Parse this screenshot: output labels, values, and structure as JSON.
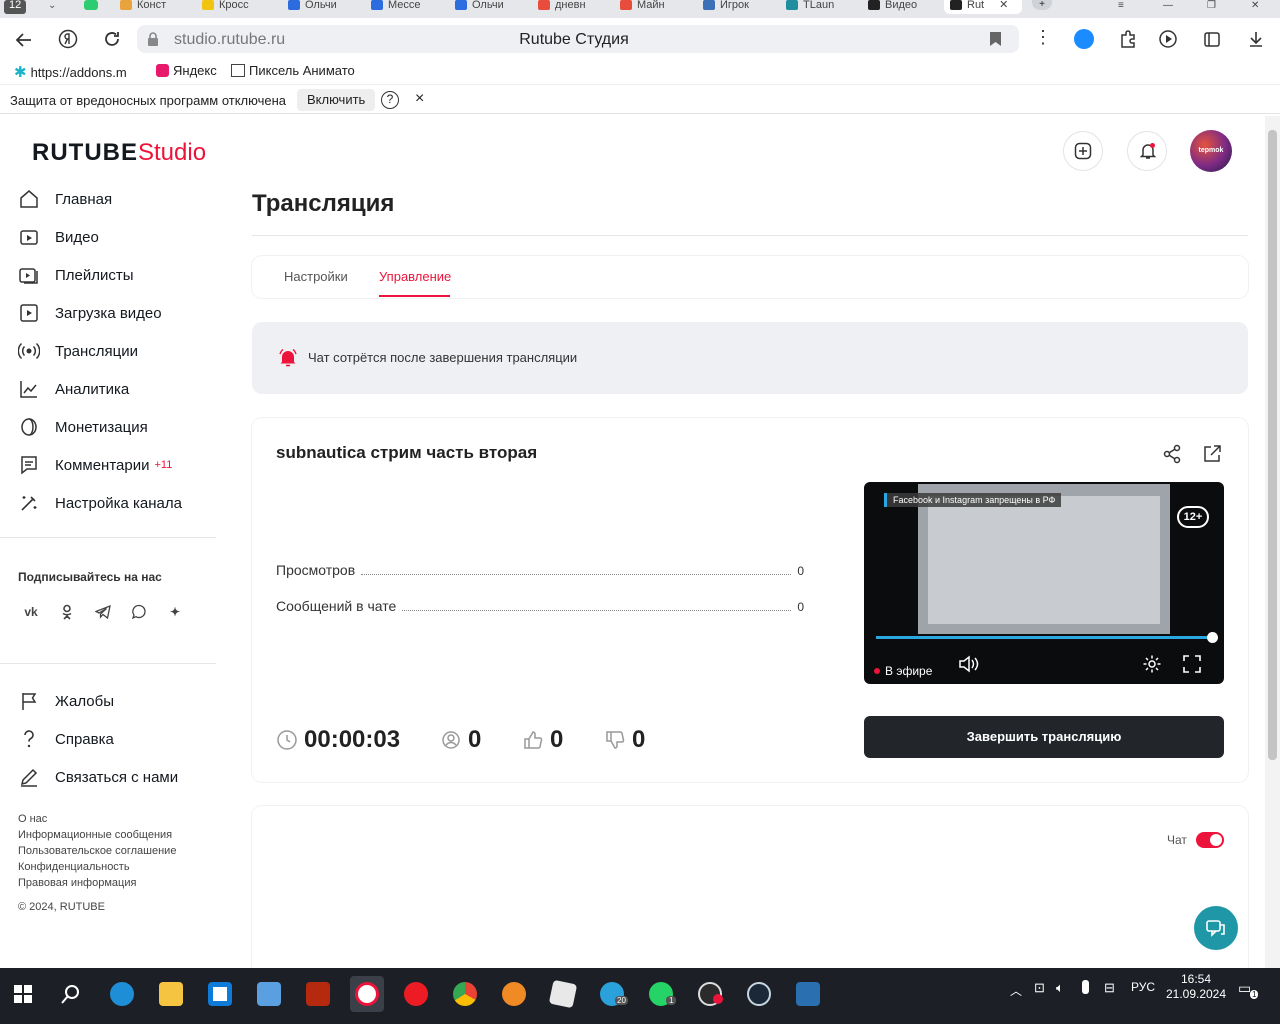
{
  "browser": {
    "tab_count": "12",
    "tabs": [
      "Конст",
      "Кросс",
      "Ольчи",
      "Мессе",
      "Ольчи",
      "дневн",
      "Майн",
      "Игрок",
      "TLaun",
      "Видео",
      "Rut"
    ],
    "url": "studio.rutube.ru",
    "page_title": "Rutube Студия",
    "bookmarks": [
      "https://addons.m",
      "Яндекс",
      "Пиксель Анимато"
    ],
    "warning": {
      "text": "Защита от вредоносных программ отключена",
      "enable_label": "Включить",
      "help": "?",
      "close": "×"
    }
  },
  "app": {
    "logo_main": "RUTUBE",
    "logo_studio": "Studio",
    "avatar_text": "tepmok",
    "nav": [
      {
        "label": "Главная",
        "icon": "home-icon"
      },
      {
        "label": "Видео",
        "icon": "video-icon"
      },
      {
        "label": "Плейлисты",
        "icon": "playlist-icon"
      },
      {
        "label": "Загрузка видео",
        "icon": "upload-icon"
      },
      {
        "label": "Трансляции",
        "icon": "broadcast-icon"
      },
      {
        "label": "Аналитика",
        "icon": "analytics-icon"
      },
      {
        "label": "Монетизация",
        "icon": "monetization-icon"
      },
      {
        "label": "Комментарии",
        "icon": "comments-icon",
        "badge": "+11"
      },
      {
        "label": "Настройка канала",
        "icon": "wand-icon"
      }
    ],
    "subscribe_title": "Подписывайтесь на нас",
    "social": [
      "vk-icon",
      "ok-icon",
      "telegram-icon",
      "viber-icon",
      "zen-icon"
    ],
    "nav_bottom": [
      {
        "label": "Жалобы",
        "icon": "flag-icon"
      },
      {
        "label": "Справка",
        "icon": "help-icon"
      },
      {
        "label": "Связаться с нами",
        "icon": "edit-icon"
      }
    ],
    "footer_links": [
      "О нас",
      "Информационные сообщения",
      "Пользовательское соглашение",
      "Конфиденциальность",
      "Правовая информация",
      "© 2024, RUTUBE"
    ]
  },
  "main": {
    "title": "Трансляция",
    "tabs": [
      {
        "label": "Настройки"
      },
      {
        "label": "Управление"
      }
    ],
    "active_tab": "Управление",
    "notice": "Чат сотрётся после завершения трансляции",
    "stream": {
      "title": "subnautica стрим часть вторая",
      "stats": [
        {
          "label": "Просмотров",
          "value": "0"
        },
        {
          "label": "Сообщений в чате",
          "value": "0"
        }
      ],
      "timer": "00:00:03",
      "viewers": "0",
      "likes": "0",
      "dislikes": "0",
      "player": {
        "notice": "Facebook и Instagram запрещены в РФ",
        "age": "12+",
        "live_label": "В эфире",
        "progress": 1.0
      },
      "end_button": "Завершить трансляцию"
    },
    "chat": {
      "label": "Чат",
      "enabled": true
    }
  },
  "taskbar": {
    "language": "РУС",
    "time": "16:54",
    "date": "21.09.2024",
    "telegram_badge": "20",
    "whatsapp_badge": "1",
    "notif_badge": "1"
  },
  "colors": {
    "accent": "#ed143b",
    "dark_button": "#22262b",
    "help_button": "#1f97a6",
    "progress": "#2aa6e0"
  }
}
